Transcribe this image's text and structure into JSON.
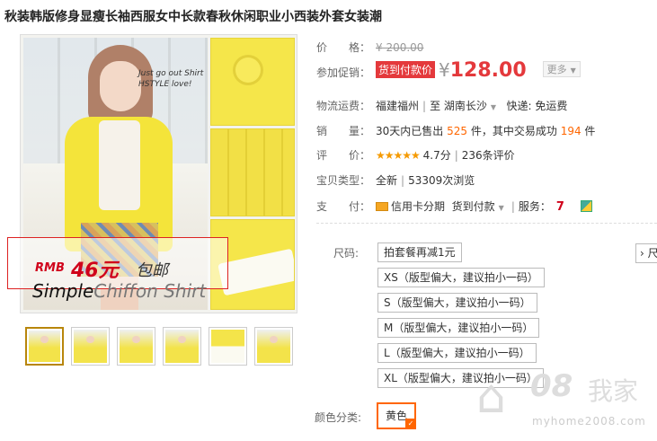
{
  "product": {
    "title": "秋装韩版修身显瘦长袖西服女中长款春秋休闲职业小西装外套女装潮"
  },
  "gallery": {
    "overlay": {
      "rmb": "RMB",
      "price": "46元",
      "free": "包邮",
      "tagline_bold": "Simple",
      "tagline_thin": "Chiffon Shirt"
    },
    "sign_text": "Just go out Shirt HSTYLE love!",
    "thumbnail_count": 6
  },
  "info": {
    "price_label": "价　　格：",
    "original_price": "¥ 200.00",
    "promo_label": "参加促销：",
    "promo_tag": "货到付款价",
    "currency": "¥",
    "promo_price": "128.00",
    "more_label": "更多",
    "shipping_label": "物流运费：",
    "ship_from": "福建福州",
    "ship_to_prefix": "至",
    "ship_to": "湖南长沙",
    "ship_fee": "快递: 免运费",
    "sales_label": "销　　量：",
    "sales_prefix": "30天内已售出",
    "sales_count": "525",
    "sales_mid": "件，其中交易成功",
    "sales_success": "194",
    "sales_suffix": "件",
    "rating_label": "评　　价：",
    "stars": "★★★★★",
    "rating_score": "4.7分",
    "rating_count": "236条评价",
    "type_label": "宝贝类型：",
    "type_value": "全新",
    "views": "53309次浏览",
    "pay_label": "支　　付：",
    "pay_credit": "信用卡分期",
    "pay_cod": "货到付款",
    "service_label": "服务：",
    "service_icon_text": "7"
  },
  "sku": {
    "size_label": "尺码:",
    "sizes": [
      "拍套餐再减1元",
      "XS（版型偏大，建议拍小一码）",
      "S（版型偏大，建议拍小一码）",
      "M（版型偏大，建议拍小一码）",
      "L（版型偏大，建议拍小一码）",
      "XL（版型偏大，建议拍小一码）"
    ],
    "more_right": "尺码",
    "color_label": "颜色分类:",
    "color_selected": "黄色"
  },
  "watermark": {
    "number": "08",
    "cn": "我家",
    "url": "myhome2008.com"
  }
}
